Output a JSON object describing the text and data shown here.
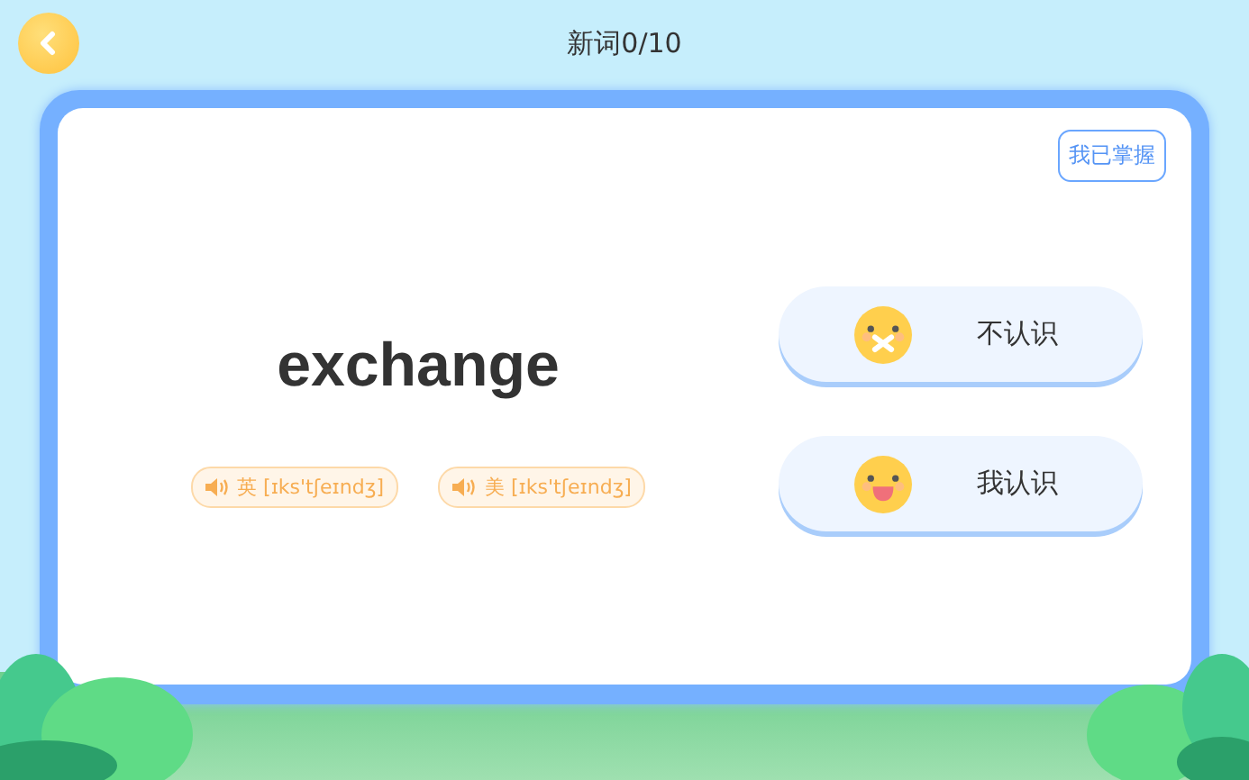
{
  "header": {
    "title": "新词0/10"
  },
  "card": {
    "mastered_button": "我已掌握",
    "word": "exchange",
    "pronunciations": [
      {
        "region": "英",
        "ipa": "[ɪks'tʃeɪndʒ]"
      },
      {
        "region": "美",
        "ipa": "[ɪks'tʃeɪndʒ]"
      }
    ],
    "answers": [
      {
        "kind": "unknown",
        "label": "不认识"
      },
      {
        "kind": "known",
        "label": "我认识"
      }
    ]
  }
}
